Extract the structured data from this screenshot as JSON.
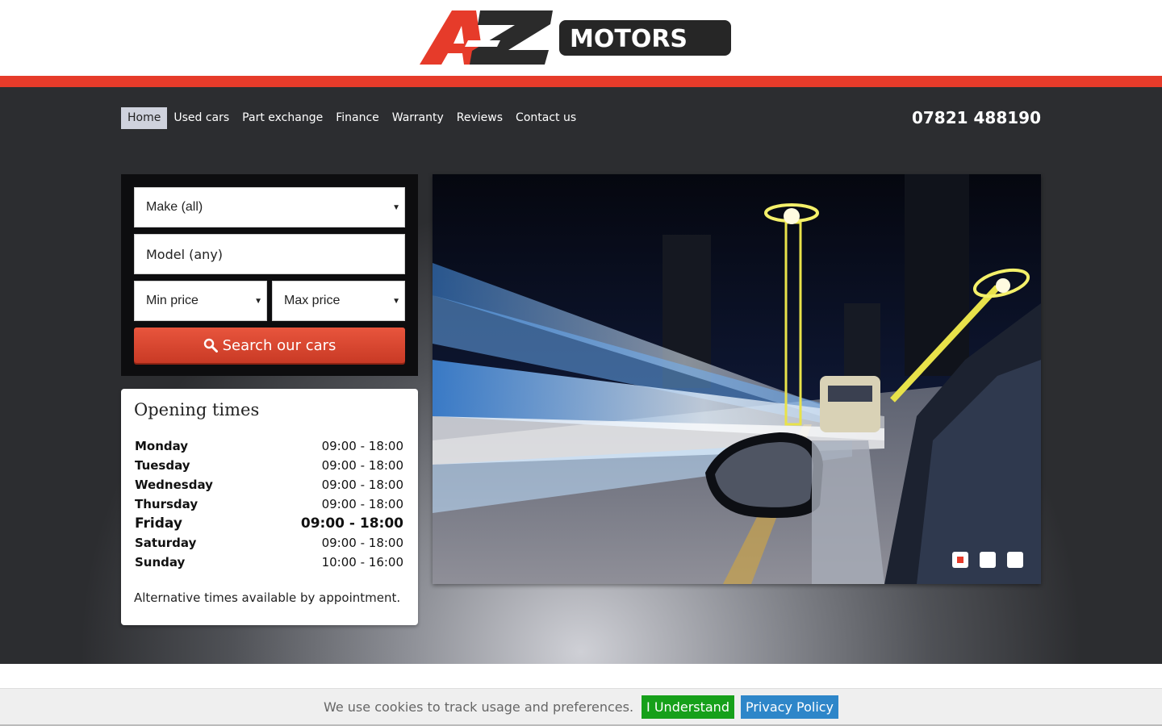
{
  "brand": {
    "logo_mark": "AZ",
    "logo_word": "MOTORS",
    "accent": "#e63b2a"
  },
  "nav": {
    "items": [
      {
        "label": "Home"
      },
      {
        "label": "Used cars"
      },
      {
        "label": "Part exchange"
      },
      {
        "label": "Finance"
      },
      {
        "label": "Warranty"
      },
      {
        "label": "Reviews"
      },
      {
        "label": "Contact us"
      }
    ],
    "active": "Home",
    "phone": "07821 488190"
  },
  "search": {
    "make": "Make (all)",
    "model": "Model (any)",
    "min_price": "Min price",
    "max_price": "Max price",
    "button": "Search our cars",
    "button_icon": "search-icon"
  },
  "opening_times": {
    "title": "Opening times",
    "days": [
      {
        "day": "Monday",
        "hours": "09:00 - 18:00"
      },
      {
        "day": "Tuesday",
        "hours": "09:00 - 18:00"
      },
      {
        "day": "Wednesday",
        "hours": "09:00 - 18:00"
      },
      {
        "day": "Thursday",
        "hours": "09:00 - 18:00"
      },
      {
        "day": "Friday",
        "hours": "09:00 - 18:00"
      },
      {
        "day": "Saturday",
        "hours": "09:00 - 18:00"
      },
      {
        "day": "Sunday",
        "hours": "10:00 - 16:00"
      }
    ],
    "highlighted_day": "Friday",
    "note": "Alternative times available by appointment."
  },
  "slider": {
    "slide_count": 3,
    "active_slide": 1
  },
  "cookie": {
    "text": "We use cookies to track usage and preferences.",
    "accept": "I Understand",
    "privacy": "Privacy Policy",
    "accept_color": "#16a01a",
    "privacy_color": "#2e86c9"
  }
}
